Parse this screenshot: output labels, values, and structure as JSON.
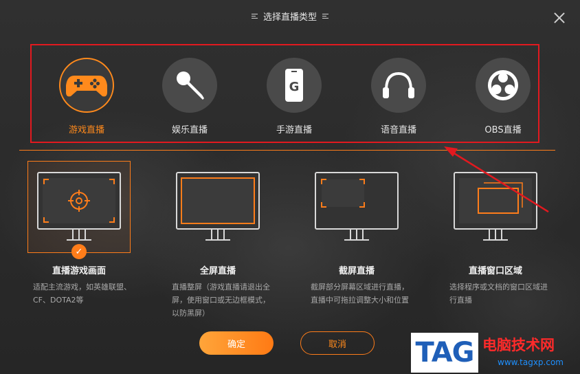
{
  "dialog": {
    "title": "选择直播类型",
    "close_icon": "close-icon"
  },
  "stream_types": [
    {
      "label": "游戏直播",
      "icon": "gamepad-icon",
      "selected": true
    },
    {
      "label": "娱乐直播",
      "icon": "microphone-icon",
      "selected": false
    },
    {
      "label": "手游直播",
      "icon": "mobile-phone-icon",
      "selected": false
    },
    {
      "label": "语音直播",
      "icon": "headphones-icon",
      "selected": false
    },
    {
      "label": "OBS直播",
      "icon": "obs-logo-icon",
      "selected": false
    }
  ],
  "capture_modes": [
    {
      "title": "直播游戏画面",
      "desc": "适配主流游戏，如英雄联盟、CF、DOTA2等",
      "icon": "game-capture-icon",
      "selected": true
    },
    {
      "title": "全屏直播",
      "desc": "直播整屏（游戏直播请退出全屏，使用窗口或无边框模式，以防黑屏）",
      "icon": "fullscreen-icon",
      "selected": false
    },
    {
      "title": "截屏直播",
      "desc": "截屏部分屏幕区域进行直播，直播中可拖拉调整大小和位置",
      "icon": "region-capture-icon",
      "selected": false
    },
    {
      "title": "直播窗口区域",
      "desc": "选择程序或文档的窗口区域进行直播",
      "icon": "window-capture-icon",
      "selected": false
    }
  ],
  "actions": {
    "confirm_label": "确定",
    "cancel_label": "取消"
  },
  "watermark": {
    "tag": "TAG",
    "name": "电脑技术网",
    "url": "www.tagxp.com"
  },
  "colors": {
    "accent": "#ff7d1a",
    "highlight_box": "#e2191f",
    "background": "#2b2b2b"
  }
}
